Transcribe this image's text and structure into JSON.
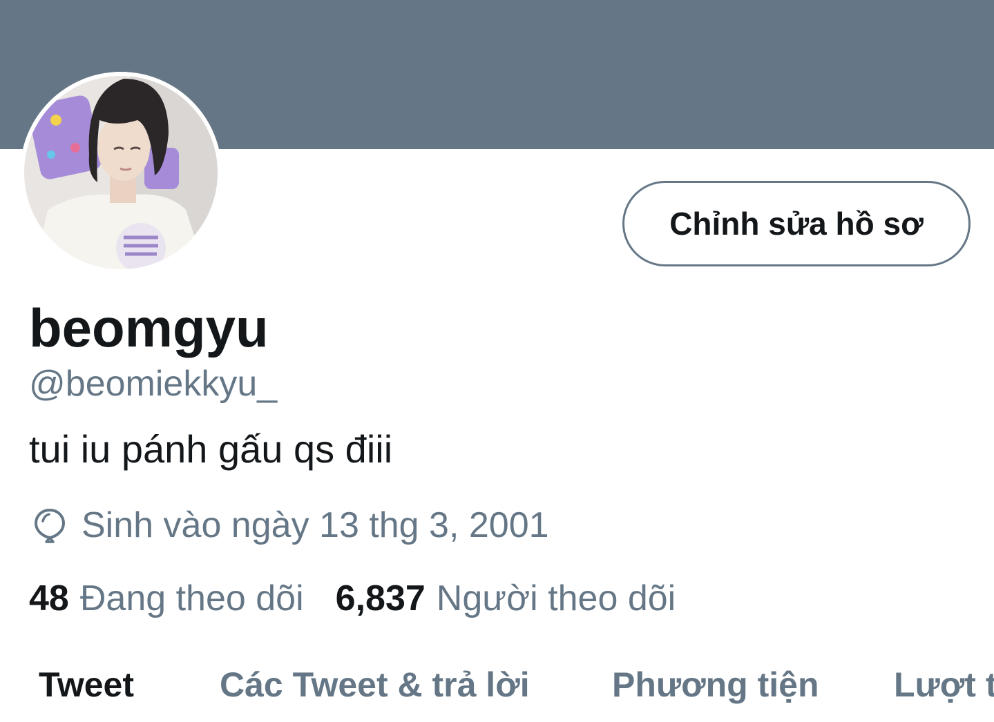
{
  "profile": {
    "edit_button_label": "Chỉnh sửa hồ sơ",
    "display_name": "beomgyu",
    "handle": "@beomiekkyu_",
    "bio": "tui iu pánh gấu qs điii",
    "birth_info": "Sinh vào ngày 13 thg 3, 2001",
    "birth_icon": "balloon-icon"
  },
  "stats": {
    "following_count": "48",
    "following_label": "Đang theo dõi",
    "followers_count": "6,837",
    "followers_label": "Người theo dõi"
  },
  "tabs": [
    {
      "label": "Tweet",
      "active": true
    },
    {
      "label": "Các Tweet & trả lời",
      "active": false
    },
    {
      "label": "Phương tiện",
      "active": false
    },
    {
      "label": "Lượt t",
      "active": false
    }
  ],
  "colors": {
    "banner": "#657786",
    "primary_text": "#14171a",
    "secondary_text": "#657786"
  }
}
